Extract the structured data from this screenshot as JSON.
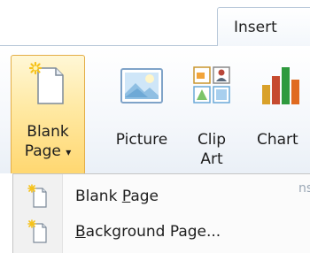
{
  "tabs": {
    "active": "Insert"
  },
  "ribbon": {
    "blank_page": {
      "line1": "Blank",
      "line2": "Page",
      "arrow": "▾"
    },
    "picture": {
      "label": "Picture"
    },
    "clip_art": {
      "line1": "Clip",
      "line2": "Art"
    },
    "chart": {
      "label": "Chart"
    }
  },
  "menu": {
    "items": [
      {
        "pre": "Blank ",
        "accel": "P",
        "post": "age",
        "icon": "blank-page-icon"
      },
      {
        "pre": "",
        "accel": "B",
        "post": "ackground Page...",
        "icon": "background-page-icon"
      }
    ],
    "ghost_text": "ns"
  },
  "colors": {
    "highlight_border": "#e3ae48",
    "highlight_fill": "#ffd770",
    "tab_border": "#b9c9da"
  }
}
